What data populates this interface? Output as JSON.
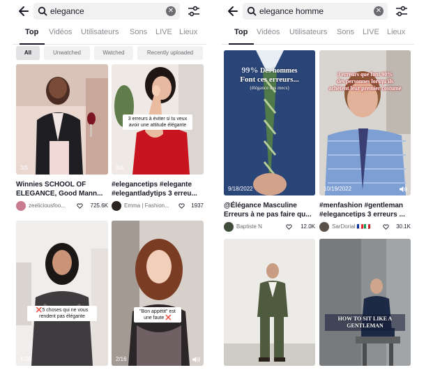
{
  "left": {
    "search_query": "elegance",
    "tabs": [
      "Top",
      "Vidéos",
      "Utilisateurs",
      "Sons",
      "LIVE",
      "Lieux"
    ],
    "active_tab": "Top",
    "chips": [
      "All",
      "Unwatched",
      "Watched",
      "Recently uploaded"
    ],
    "cards": [
      {
        "badge": "3/5",
        "overlay": "",
        "caption_line1": "Winnies SCHOOL OF",
        "caption_line2": "ELEGANCE, Good Mann...",
        "author": "zeeliciousfoo...",
        "likes": "725.6K"
      },
      {
        "badge": "3/8",
        "overlay": "3 erreurs à éviter si tu veux avoir une attitude élégante",
        "caption_line1": "#elegancetips #elegante",
        "caption_line2": "#elegantladytips 3 erreu...",
        "author": "Emma | Fashion...",
        "likes": "1937"
      },
      {
        "badge": "1/28",
        "overlay_mark": "❌",
        "overlay": "5 choses qui ne vous rendent pas élégante"
      },
      {
        "badge": "2/16",
        "overlay": "\"Bon appétit\" est une faute",
        "overlay_mark": "❌"
      }
    ]
  },
  "right": {
    "search_query": "elegance homme",
    "tabs": [
      "Top",
      "Vidéos",
      "Utilisateurs",
      "Sons",
      "LIVE",
      "Lieux"
    ],
    "active_tab": "Top",
    "cards": [
      {
        "badge": "9/18/2022",
        "overlay_line1_accent": "99%",
        "overlay_line1_rest": "Des hommes",
        "overlay_line2": "Font ces erreurs...",
        "overlay_line3": "(élégance des mecs)",
        "caption_line1": "@Élégance Masculine",
        "caption_line2": "Erreurs à ne pas faire qu...",
        "author": "Baptiste N",
        "likes": "12.0K"
      },
      {
        "badge": "10/19/2022",
        "overlay_line1": "3 erreurs que font 90%",
        "overlay_line2": "des personnes lorsqu'ils",
        "overlay_line3": "achètent leur premier costume",
        "caption_line1": "#menfashion #gentleman",
        "caption_line2": "#elegancetips 3 erreurs ...",
        "author": "SarDorial 🇫🇷🇮🇹",
        "likes": "30.1K"
      },
      {
        "overlay": ""
      },
      {
        "overlay_line1": "HOW TO SIT LIKE A",
        "overlay_line2": "GENTLEMAN"
      }
    ]
  }
}
